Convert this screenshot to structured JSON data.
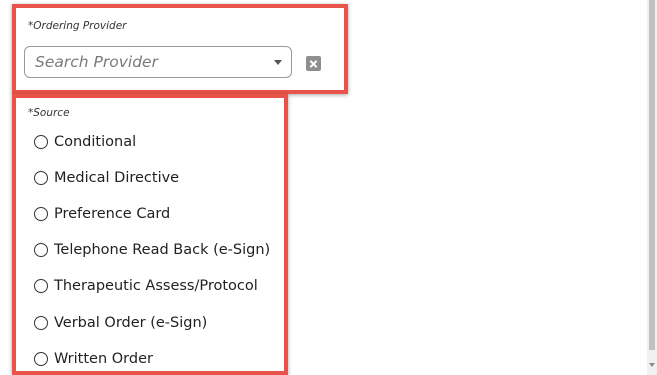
{
  "ordering_provider": {
    "label": "*Ordering Provider",
    "placeholder": "Search Provider",
    "dropdown_icon": "chevron-down-icon",
    "clear_icon": "close-icon"
  },
  "source": {
    "label": "*Source",
    "selected": null,
    "options": [
      {
        "label": "Conditional"
      },
      {
        "label": "Medical Directive"
      },
      {
        "label": "Preference Card"
      },
      {
        "label": "Telephone Read Back (e-Sign)"
      },
      {
        "label": "Therapeutic Assess/Protocol"
      },
      {
        "label": "Verbal Order (e-Sign)"
      },
      {
        "label": "Written Order"
      }
    ]
  },
  "colors": {
    "highlight_border": "#e8544a",
    "placeholder_text": "#7a7a7a",
    "clear_button": "#8f8f8f"
  }
}
